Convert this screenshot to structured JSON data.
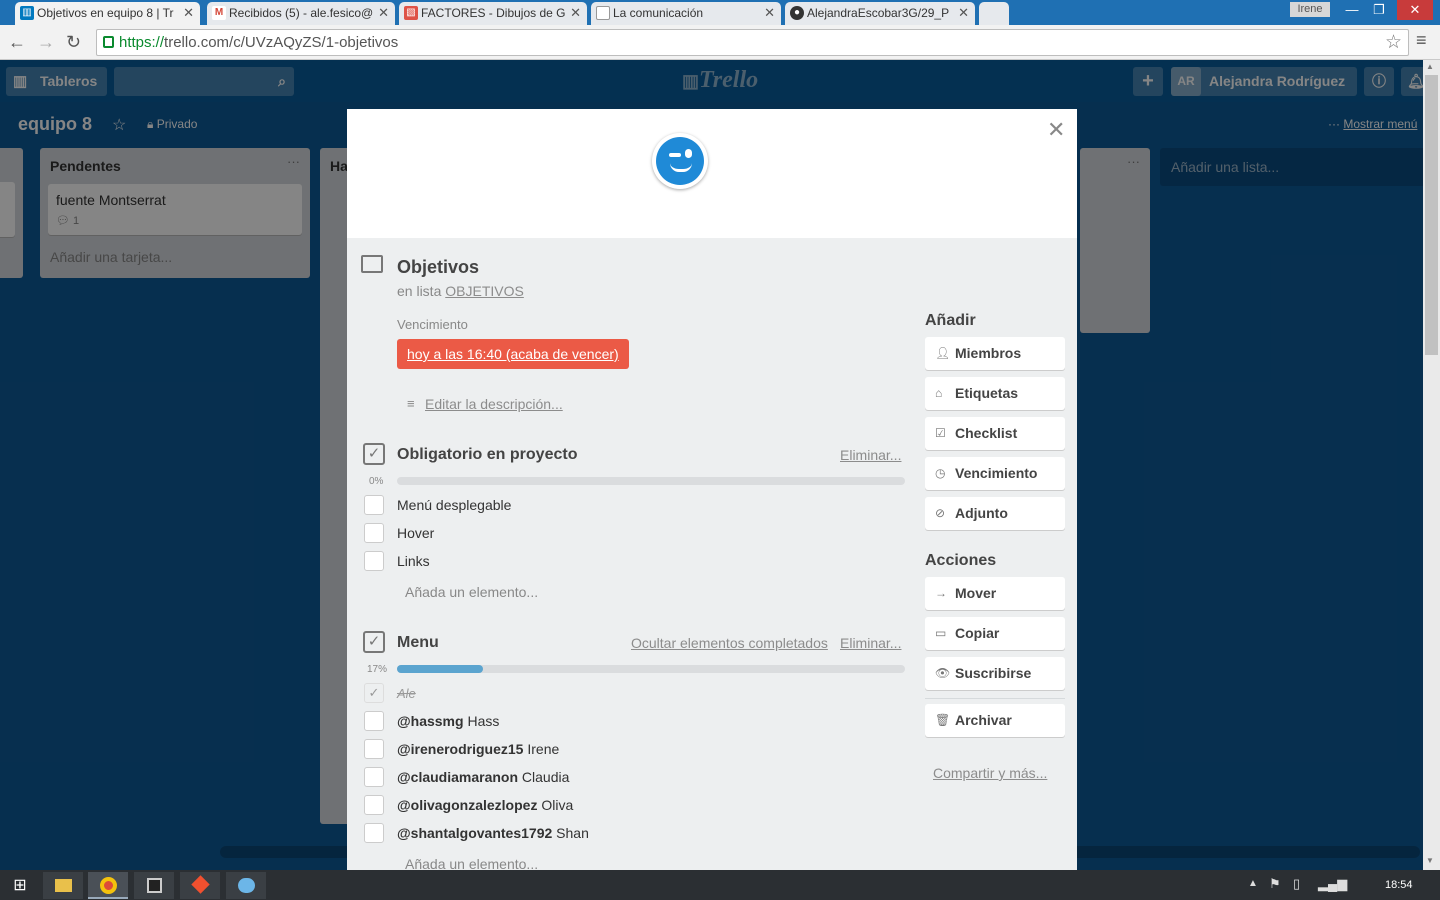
{
  "browser": {
    "tabs": [
      {
        "title": "Objetivos en equipo 8 | Tr",
        "icon": "trello-icon",
        "color": "#0079bf"
      },
      {
        "title": "Recibidos (5) - ale.fesico@",
        "icon": "gmail-icon",
        "color": "#d44638"
      },
      {
        "title": "FACTORES - Dibujos de G",
        "icon": "drawings-icon",
        "color": "#de5246"
      },
      {
        "title": "La comunicación",
        "icon": "document-icon",
        "color": "#888888"
      },
      {
        "title": "AlejandraEscobar3G/29_P",
        "icon": "github-icon",
        "color": "#333333"
      }
    ],
    "profile": "Irene",
    "url_scheme": "https://",
    "url_rest": "trello.com/c/UVzAQyZS/1-objetivos"
  },
  "header": {
    "boards_label": "Tableros",
    "logo": "Trello",
    "avatar_initials": "AR",
    "user_name": "Alejandra Rodríguez"
  },
  "board": {
    "name": "equipo 8",
    "privacy": "Privado",
    "show_menu": "Mostrar menú",
    "add_list": "Añadir una lista...",
    "lists": [
      {
        "title": "Pendentes",
        "cards": [
          {
            "title": "fuente Montserrat",
            "comments": "1"
          }
        ],
        "add_card": "Añadir una tarjeta..."
      }
    ],
    "partial_list_title": "Ha"
  },
  "card": {
    "title": "Objetivos",
    "in_list_prefix": "en lista",
    "list_name": "OBJETIVOS",
    "due_label": "Vencimiento",
    "due_value": "hoy a las 16:40 (acaba de vencer)",
    "edit_description": "Editar la descripción...",
    "checklists": [
      {
        "title": "Obligatorio en proyecto",
        "progress_label": "0%",
        "progress": 0,
        "delete": "Eliminar...",
        "items": [
          {
            "text": "Menú desplegable",
            "done": false
          },
          {
            "text": "Hover",
            "done": false
          },
          {
            "text": "Links",
            "done": false
          }
        ],
        "add_item": "Añada un elemento..."
      },
      {
        "title": "Menu",
        "progress_label": "17%",
        "progress": 0.17,
        "hide_completed": "Ocultar elementos completados",
        "delete": "Eliminar...",
        "items": [
          {
            "mention": "",
            "text": "Ale",
            "done": true
          },
          {
            "mention": "@hassmg",
            "text": "Hass",
            "done": false
          },
          {
            "mention": "@irenerodriguez15",
            "text": "Irene",
            "done": false
          },
          {
            "mention": "@claudiamaranon",
            "text": "Claudia",
            "done": false
          },
          {
            "mention": "@olivagonzalezlopez",
            "text": "Oliva",
            "done": false
          },
          {
            "mention": "@shantalgovantes1792",
            "text": "Shan",
            "done": false
          }
        ],
        "add_item": "Añada un elemento..."
      }
    ]
  },
  "sidebar": {
    "add_title": "Añadir",
    "add_buttons": [
      "Miembros",
      "Etiquetas",
      "Checklist",
      "Vencimiento",
      "Adjunto"
    ],
    "actions_title": "Acciones",
    "action_buttons": [
      "Mover",
      "Copiar",
      "Suscribirse"
    ],
    "archive": "Archivar",
    "share": "Compartir y más..."
  },
  "taskbar": {
    "time": "18:54"
  },
  "colors": {
    "due_red": "#eb5a46",
    "progress_blue": "#5ba4cf",
    "board_bg": "#0079bf"
  }
}
